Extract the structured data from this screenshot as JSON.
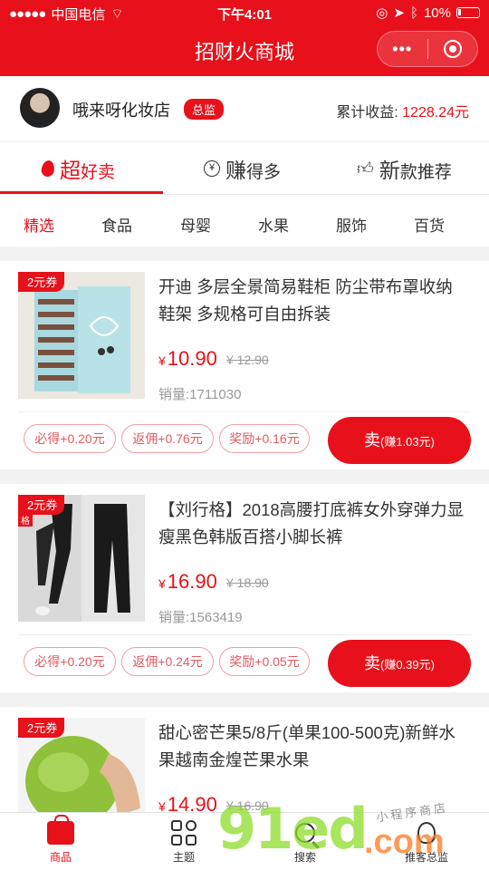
{
  "status": {
    "carrier": "中国电信",
    "time": "下午4:01",
    "battery": "10%"
  },
  "nav": {
    "title": "招财火商城",
    "more_icon": "more-dots-icon",
    "close_icon": "mini-program-close-icon"
  },
  "shop": {
    "name": "哦来呀化妆店",
    "role_badge": "总监",
    "earnings_label": "累计收益:",
    "earnings_value": "1228.24元"
  },
  "tabs": [
    {
      "big": "超",
      "rest": "好卖",
      "icon": "flame-icon"
    },
    {
      "big": "赚",
      "rest": "得多",
      "icon": "yen-circle-icon"
    },
    {
      "big": "新",
      "rest": "款推荐",
      "icon": "thumbs-up-icon"
    }
  ],
  "categories": [
    "精选",
    "食品",
    "母婴",
    "水果",
    "服饰",
    "百货"
  ],
  "products": [
    {
      "coupon": "2元券",
      "title": "开迪 多层全景简易鞋柜 防尘带布罩收纳鞋架 多规格可自由拆装",
      "price": "10.90",
      "original_price": "¥ 12.90",
      "sales": "销量:1711030",
      "tags": [
        "必得+0.20元",
        "返佣+0.76元",
        "奖励+0.16元"
      ],
      "sell_label": "卖",
      "sell_earn": "(赚1.03元)"
    },
    {
      "coupon": "2元券",
      "coupon_sub": "格",
      "title": "【刘行格】2018高腰打底裤女外穿弹力显瘦黑色韩版百搭小脚长裤",
      "price": "16.90",
      "original_price": "¥ 18.90",
      "sales": "销量:1563419",
      "tags": [
        "必得+0.20元",
        "返佣+0.24元",
        "奖励+0.05元"
      ],
      "sell_label": "卖",
      "sell_earn": "(赚0.39元)"
    },
    {
      "coupon": "2元券",
      "title": "甜心密芒果5/8斤(单果100-500克)新鲜水果越南金煌芒果水果",
      "price": "14.90",
      "original_price": "¥ 16.90"
    }
  ],
  "currency_symbol": "¥",
  "tabbar": [
    {
      "label": "商品",
      "icon": "shopping-bag-icon"
    },
    {
      "label": "主题",
      "icon": "grid-icon"
    },
    {
      "label": "搜索",
      "icon": "search-icon"
    },
    {
      "label": "推客总监",
      "icon": "lightbulb-icon"
    }
  ],
  "watermark": {
    "main": "91ed",
    "suffix": ".com",
    "handwriting": "小程序商店"
  },
  "colors": {
    "brand_red": "#e8101a",
    "watermark_green": "#8cdc28",
    "watermark_orange": "#ff781e"
  }
}
